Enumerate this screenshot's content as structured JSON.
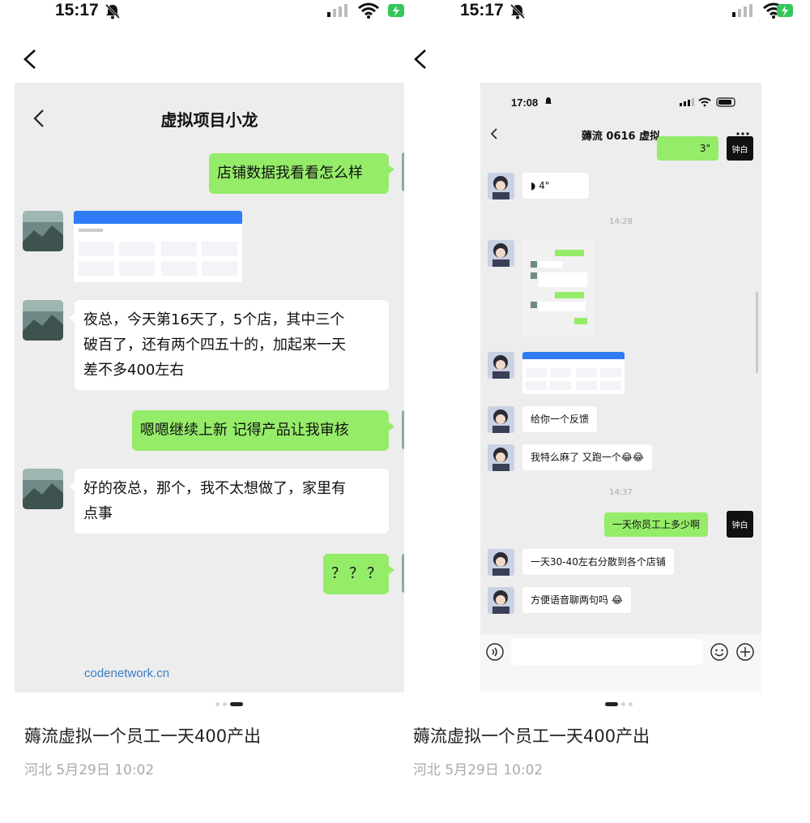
{
  "left_panel": {
    "status": {
      "time": "15:17"
    },
    "post": {
      "title": "薅流虚拟一个员工一天400产出",
      "meta": "河北  5月29日  10:02"
    },
    "screenshot": {
      "chat_title": "虚拟项目小龙",
      "messages": [
        {
          "side": "right",
          "text": "店铺数据我看看怎么样"
        },
        {
          "side": "left",
          "type": "image"
        },
        {
          "side": "left",
          "lines": [
            "夜总，今天第16天了，5个店，其中三个",
            "破百了，还有两个四五十的，加起来一天",
            "差不多400左右"
          ]
        },
        {
          "side": "right",
          "text": "嗯嗯继续上新  记得产品让我审核"
        },
        {
          "side": "left",
          "lines": [
            "好的夜总，那个，我不太想做了，家里有",
            "点事"
          ]
        },
        {
          "side": "right",
          "text": "？？？"
        }
      ],
      "watermark": "codenetwork.cn"
    }
  },
  "right_panel": {
    "status": {
      "time": "15:17"
    },
    "post": {
      "title": "薅流虚拟一个员工一天400产出",
      "meta": "河北  5月29日  10:02"
    },
    "screenshot": {
      "status_time": "17:08",
      "chat_title": "薅流 0616 虚拟",
      "voice_top": "3\"",
      "voice_in": "4\"",
      "time_1": "14:28",
      "time_2": "14:37",
      "messages": {
        "feedback": "给你一个反馈",
        "ran_away": "我特么麻了 又跑一个😂😂",
        "ask_output": "一天你员工上多少啊",
        "answer_output": "一天30-40左右分散到各个店铺",
        "voice_chat": "方便语音聊两句吗 😂"
      },
      "my_avatar_text": "钟白"
    }
  },
  "colors": {
    "green_bubble": "#95ec69",
    "chat_bg": "#ededed",
    "watermark": "#3d7bc6"
  }
}
